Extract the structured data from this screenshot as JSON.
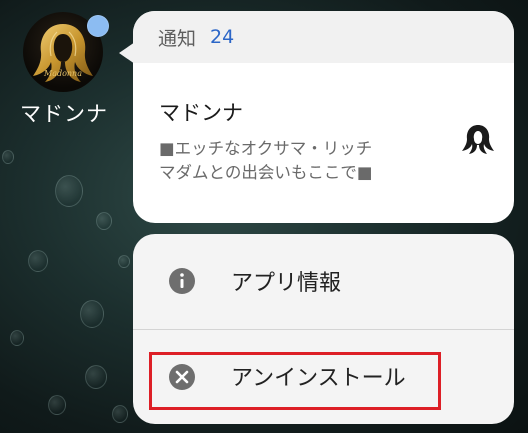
{
  "app": {
    "name": "マドンナ",
    "logo_text": "Madonna",
    "has_notification_dot": true,
    "notification_dot_color": "#8cbcf2"
  },
  "notification": {
    "header_title": "通知",
    "count": "24",
    "count_color": "#2c66c7",
    "title": "マドンナ",
    "message_line1": "■エッチなオクサマ・リッチ",
    "message_line2": "マダムとの出会いもここで■"
  },
  "menu": {
    "items": [
      {
        "label": "アプリ情報",
        "icon": "info-icon"
      },
      {
        "label": "アンインストール",
        "icon": "close-circle-icon",
        "highlighted": true
      }
    ],
    "highlight_color": "#dd1f26"
  }
}
